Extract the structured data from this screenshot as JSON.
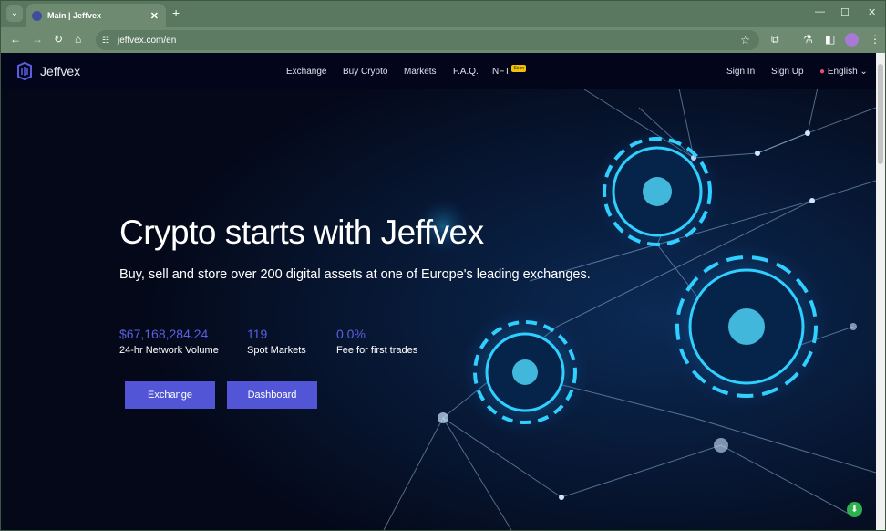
{
  "browser": {
    "tab_title": "Main | Jeffvex",
    "url": "jeffvex.com/en"
  },
  "nav": {
    "brand": "Jeffvex",
    "links": [
      "Exchange",
      "Buy Crypto",
      "Markets",
      "F.A.Q.",
      "NFT"
    ],
    "nft_badge": "Soon",
    "sign_in": "Sign In",
    "sign_up": "Sign Up",
    "language": "English"
  },
  "hero": {
    "title": "Crypto starts with Jeffvex",
    "subtitle": "Buy, sell and store over 200 digital assets at one of Europe's leading exchanges.",
    "stats": [
      {
        "value": "$67,168,284.24",
        "label": "24-hr Network Volume"
      },
      {
        "value": "119",
        "label": "Spot Markets"
      },
      {
        "value": "0.0%",
        "label": "Fee for first trades"
      }
    ],
    "buttons": {
      "exchange": "Exchange",
      "dashboard": "Dashboard"
    }
  },
  "colors": {
    "accent": "#5256d6",
    "stat": "#5b5fe0",
    "browser_frame": "#6e8b72"
  }
}
